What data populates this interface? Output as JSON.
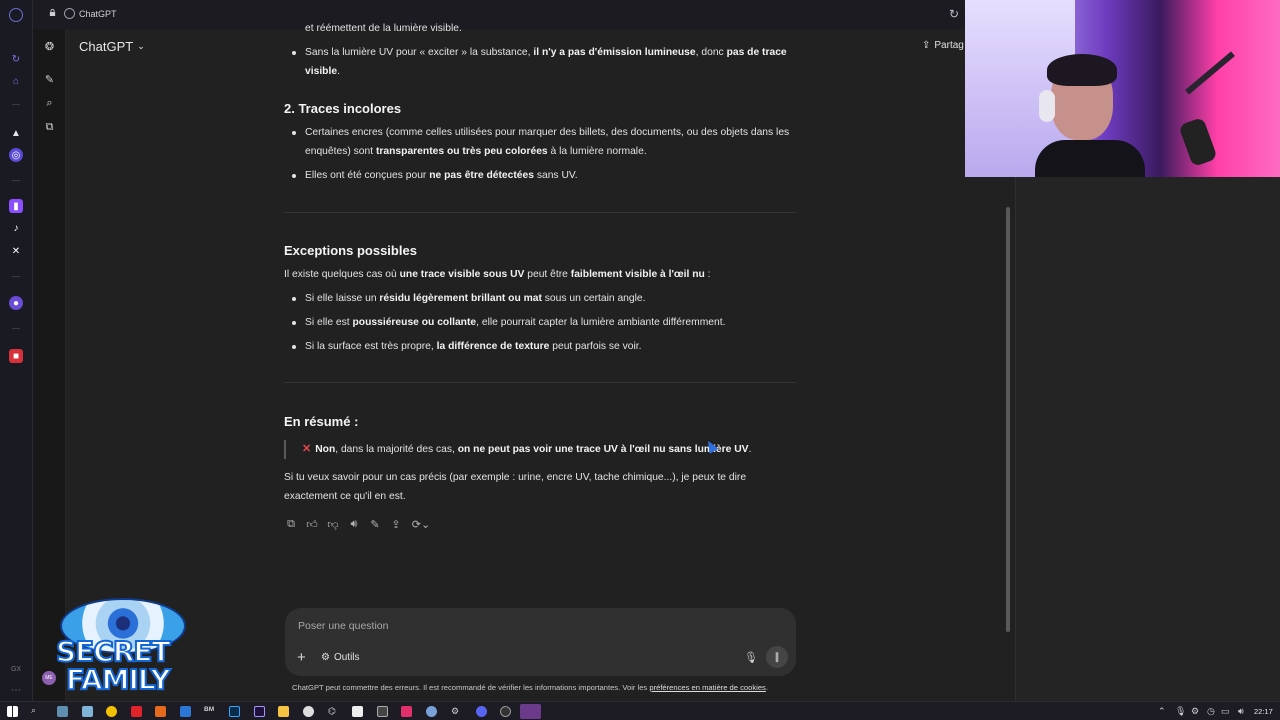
{
  "browser": {
    "tab_title": "ChatGPT",
    "share_label": "Partag"
  },
  "header": {
    "model_label": "ChatGPT"
  },
  "content": {
    "intro_cut": "et réémettent de la lumière visible.",
    "bullet_uv": {
      "a": "Sans la lumière UV pour « exciter » la substance, ",
      "b": "il n'y a pas d'émission lumineuse",
      "c": ", donc ",
      "d": "pas de trace visible",
      "e": "."
    },
    "section2_title": "2. Traces incolores",
    "s2_bullet1": {
      "a": "Certaines encres (comme celles utilisées pour marquer des billets, des documents, ou des objets dans les enquêtes) sont ",
      "b": "transparentes ou très peu colorées",
      "c": " à la lumière normale."
    },
    "s2_bullet2": {
      "a": "Elles ont été conçues pour ",
      "b": "ne pas être détectées",
      "c": " sans UV."
    },
    "exceptions_title": "Exceptions possibles",
    "exceptions_intro": {
      "a": "Il existe quelques cas où ",
      "b": "une trace visible sous UV",
      "c": " peut être ",
      "d": "faiblement visible à l'œil nu",
      "e": " :"
    },
    "exc_bullet1": {
      "a": "Si elle laisse un ",
      "b": "résidu légèrement brillant ou mat",
      "c": " sous un certain angle."
    },
    "exc_bullet2": {
      "a": "Si elle est ",
      "b": "poussiéreuse ou collante",
      "c": ", elle pourrait capter la lumière ambiante différemment."
    },
    "exc_bullet3": {
      "a": "Si la surface est très propre, ",
      "b": "la différence de texture",
      "c": " peut parfois se voir."
    },
    "summary_title": "En résumé :",
    "summary_quote": {
      "x": "✕",
      "a": "Non",
      "b": ", dans la majorité des cas, ",
      "c": "on ne peut pas voir une trace UV à l'œil nu sans lumière UV",
      "d": "."
    },
    "closing": "Si tu veux savoir pour un cas précis (par exemple : urine, encre UV, tache chimique...), je peux te dire exactement ce qu'il en est."
  },
  "composer": {
    "placeholder": "Poser une question",
    "tools_label": "Outils"
  },
  "disclaimer": {
    "text": "ChatGPT peut commettre des erreurs. Il est recommandé de vérifier les informations importantes. Voir les ",
    "link": "préférences en matière de cookies",
    "end": "."
  },
  "overlay_logo": {
    "line1": "SECRET",
    "line2": "FAMILY"
  },
  "sidebar_avatar": "ME",
  "taskbar": {
    "clock": "22:17",
    "bm_label": "BM"
  },
  "colors": {
    "background": "#212121",
    "composer": "#303030",
    "accent_purple": "#6a3bd2",
    "error_red": "#e5484d"
  }
}
